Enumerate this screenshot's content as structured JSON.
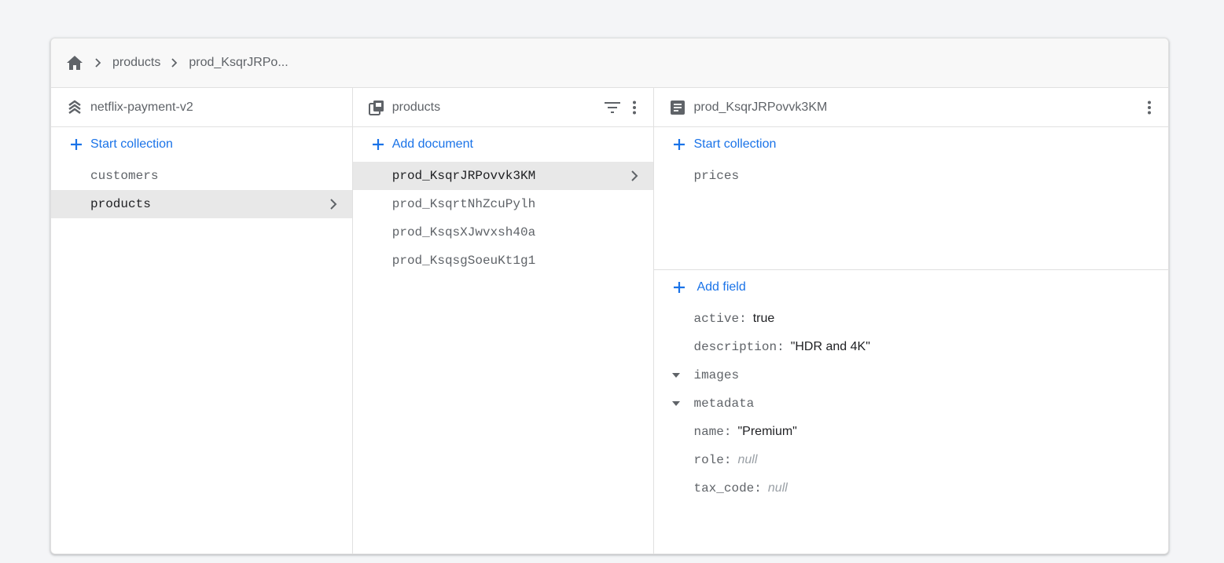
{
  "breadcrumb": {
    "home_icon": "home-icon",
    "items": [
      "products",
      "prod_KsqrJRPo..."
    ]
  },
  "columns": {
    "root": {
      "title": "netflix-payment-v2",
      "icon": "database-icon",
      "action_label": "Start collection",
      "items": [
        "customers",
        "products"
      ],
      "selected_index": 1
    },
    "collection": {
      "title": "products",
      "icon": "collection-icon",
      "action_label": "Add document",
      "items": [
        "prod_KsqrJRPovvk3KM",
        "prod_KsqrtNhZcuPylh",
        "prod_KsqsXJwvxsh40a",
        "prod_KsqsgSoeuKt1g1"
      ],
      "selected_index": 0
    },
    "document": {
      "title": "prod_KsqrJRPovvk3KM",
      "icon": "document-icon",
      "collection_action_label": "Start collection",
      "subcollections": [
        "prices"
      ],
      "field_action_label": "Add field",
      "fields": [
        {
          "key": "active:",
          "value": "true",
          "type": "boolean"
        },
        {
          "key": "description:",
          "value": "\"HDR and 4K\"",
          "type": "string"
        },
        {
          "key": "images",
          "type": "array",
          "expanded": true
        },
        {
          "key": "metadata",
          "type": "map",
          "expanded": true
        },
        {
          "key": "name:",
          "value": "\"Premium\"",
          "type": "string"
        },
        {
          "key": "role:",
          "value": "null",
          "type": "null"
        },
        {
          "key": "tax_code:",
          "value": "null",
          "type": "null"
        }
      ]
    }
  },
  "colors": {
    "accent": "#1a73e8",
    "selected_row": "#e8e8e8",
    "header_bg": "#f8f8f8",
    "page_bg": "#f4f5f7"
  }
}
